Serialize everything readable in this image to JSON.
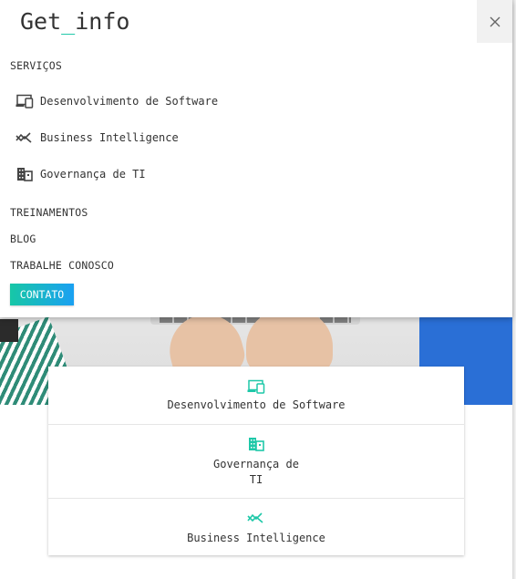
{
  "header": {
    "logo_prefix": "Get",
    "logo_underscore": "_",
    "logo_suffix": "info"
  },
  "menu": {
    "servicos": "SERVIÇOS",
    "items": [
      {
        "label": "Desenvolvimento de Software",
        "icon": "devices-icon"
      },
      {
        "label": "Business Intelligence",
        "icon": "trending-icon"
      },
      {
        "label": "Governança de TI",
        "icon": "building-icon"
      }
    ],
    "treinamentos": "TREINAMENTOS",
    "blog": "BLOG",
    "trabalhe": "TRABALHE CONOSCO",
    "contato": "CONTATO"
  },
  "cards": [
    {
      "line1": "Desenvolvimento de Software",
      "line2": "",
      "icon": "devices-icon"
    },
    {
      "line1": "Governança de",
      "line2": "TI",
      "icon": "building-icon"
    },
    {
      "line1": "Business Intelligence",
      "line2": "",
      "icon": "trending-icon"
    }
  ],
  "colors": {
    "accent": "#1ec8a8",
    "cta_start": "#17c7a6",
    "cta_end": "#1aa0f2"
  }
}
